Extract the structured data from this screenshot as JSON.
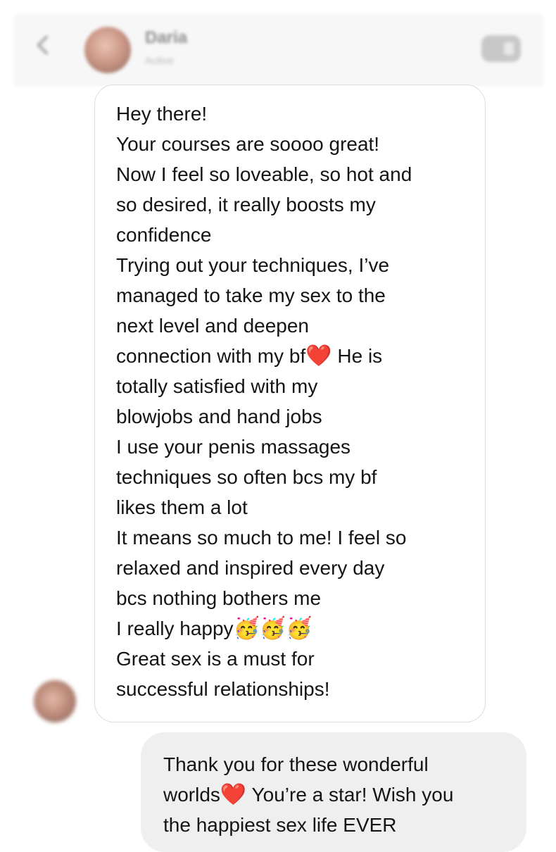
{
  "header": {
    "contact_name": "Daria",
    "contact_status": "Active",
    "video_call_icon": "video-camera-icon",
    "back_icon": "chevron-left-icon"
  },
  "colors": {
    "header_background": "#f7f7f7",
    "incoming_bubble_border": "#dcdcdc",
    "outgoing_bubble_background": "#efefef",
    "heart": "#e02d2d"
  },
  "messages": {
    "incoming": {
      "lines": [
        "Hey there!",
        "Your courses are soooo great!",
        "Now I feel so loveable, so hot and",
        "so desired, it really boosts my",
        "confidence",
        "Trying out your techniques, I’ve",
        "managed to take my sex to the",
        "next level and deepen",
        "connection with my bf",
        " He is",
        "totally  satisfied with my",
        "blowjobs and hand jobs",
        "I use your penis massages",
        "techniques so often bcs my bf",
        "likes them a lot",
        "It means so much to me! I feel so",
        "relaxed and inspired every day",
        "bcs nothing bothers me",
        "I really happy",
        "Great sex is a must for",
        "successful relationships!"
      ],
      "emojis": {
        "heart": "❤️",
        "party_face": "🥳"
      }
    },
    "outgoing": {
      "lines": [
        "Thank you for these wonderful",
        "worlds",
        " You’re a star! Wish you",
        "the happiest sex life EVER"
      ],
      "emojis": {
        "heart": "❤️"
      }
    }
  }
}
